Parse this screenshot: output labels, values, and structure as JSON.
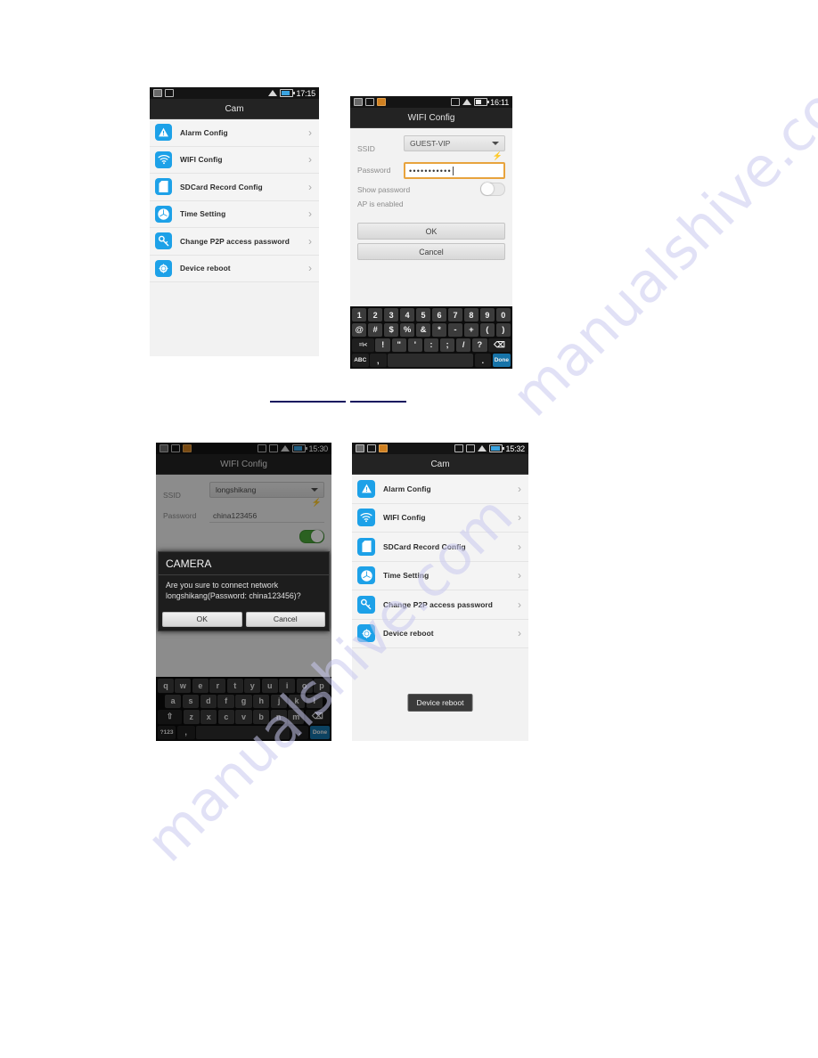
{
  "page": {
    "watermark_lines": [
      "manualshive.com",
      "manualshive.com"
    ]
  },
  "figures": [
    {
      "id": "fig-cam-menu",
      "status_bar": {
        "icons": [
          "sms-icon",
          "gallery-icon"
        ],
        "right_icons": [
          "wifi-icon",
          "battery-icon"
        ],
        "time": "17:15"
      },
      "title": "Cam",
      "menu": [
        {
          "icon": "alarm-warning-icon",
          "label": "Alarm Config",
          "chevron": "›"
        },
        {
          "icon": "wifi-icon",
          "label": "WIFI Config",
          "chevron": "›"
        },
        {
          "icon": "sdcard-icon",
          "label": "SDCard Record Config",
          "chevron": "›"
        },
        {
          "icon": "clock-icon",
          "label": "Time Setting",
          "chevron": "›"
        },
        {
          "icon": "key-icon",
          "label": "Change P2P access password",
          "chevron": "›"
        },
        {
          "icon": "reboot-icon",
          "label": "Device reboot",
          "chevron": "›"
        }
      ]
    },
    {
      "id": "fig-wifi-config-keyboard",
      "status_bar": {
        "icons": [
          "sms-icon",
          "gallery-icon",
          "download-icon"
        ],
        "right_icons": [
          "alarm-icon",
          "wifi-icon",
          "battery-icon"
        ],
        "time": "16:11"
      },
      "title": "WIFI Config",
      "form": {
        "ssid_label": "SSID",
        "ssid_value": "GUEST-VIP",
        "refresh_glyph": "⚡",
        "password_label": "Password",
        "password_value": "•••••••••••",
        "show_password_label": "Show password",
        "show_password_on": false,
        "ap_label": "AP is enabled",
        "ok_label": "OK",
        "cancel_label": "Cancel"
      },
      "keyboard": {
        "type": "symbols",
        "rows": [
          [
            "1",
            "2",
            "3",
            "4",
            "5",
            "6",
            "7",
            "8",
            "9",
            "0"
          ],
          [
            "@",
            "#",
            "$",
            "%",
            "&",
            "*",
            "-",
            "+",
            "(",
            ")"
          ],
          [
            "=\\<",
            "!",
            "\"",
            "'",
            ":",
            ";",
            "/",
            "?",
            "⌫"
          ],
          [
            "ABC",
            ",",
            "",
            ".",
            "Done"
          ]
        ]
      }
    },
    {
      "id": "fig-confirm-dialog",
      "status_bar": {
        "icons": [
          "sms-icon",
          "gallery-icon",
          "download-icon"
        ],
        "right_icons": [
          "bluetooth-icon",
          "alarm-icon",
          "wifi-icon",
          "battery-icon"
        ],
        "time": "15:30"
      },
      "title": "WIFI Config",
      "form": {
        "ssid_label": "SSID",
        "ssid_value": "longshikang",
        "refresh_glyph": "⚡",
        "password_label": "Password",
        "password_value": "china123456",
        "show_password_on": true
      },
      "dialog": {
        "title": "CAMERA",
        "message": "Are you sure to connect network longshikang(Password: china123456)?",
        "ok_label": "OK",
        "cancel_label": "Cancel"
      },
      "keyboard": {
        "type": "letters",
        "rows": [
          [
            "q",
            "w",
            "e",
            "r",
            "t",
            "y",
            "u",
            "i",
            "o",
            "p"
          ],
          [
            "a",
            "s",
            "d",
            "f",
            "g",
            "h",
            "j",
            "k",
            "l"
          ],
          [
            "⇧",
            "z",
            "x",
            "c",
            "v",
            "b",
            "n",
            "m",
            "⌫"
          ],
          [
            "?123",
            ",",
            "",
            ".",
            "Done"
          ]
        ]
      }
    },
    {
      "id": "fig-device-reboot-toast",
      "status_bar": {
        "icons": [
          "sms-icon",
          "gallery-icon",
          "download-icon"
        ],
        "right_icons": [
          "bluetooth-icon",
          "alarm-icon",
          "wifi-icon",
          "battery-icon"
        ],
        "time": "15:32"
      },
      "title": "Cam",
      "menu": [
        {
          "icon": "alarm-warning-icon",
          "label": "Alarm Config",
          "chevron": "›"
        },
        {
          "icon": "wifi-icon",
          "label": "WIFI Config",
          "chevron": "›"
        },
        {
          "icon": "sdcard-icon",
          "label": "SDCard Record Config",
          "chevron": "›"
        },
        {
          "icon": "clock-icon",
          "label": "Time Setting",
          "chevron": "›"
        },
        {
          "icon": "key-icon",
          "label": "Change P2P access password",
          "chevron": "›"
        },
        {
          "icon": "reboot-icon",
          "label": "Device reboot",
          "chevron": "›"
        }
      ],
      "toast": "Device reboot"
    }
  ]
}
